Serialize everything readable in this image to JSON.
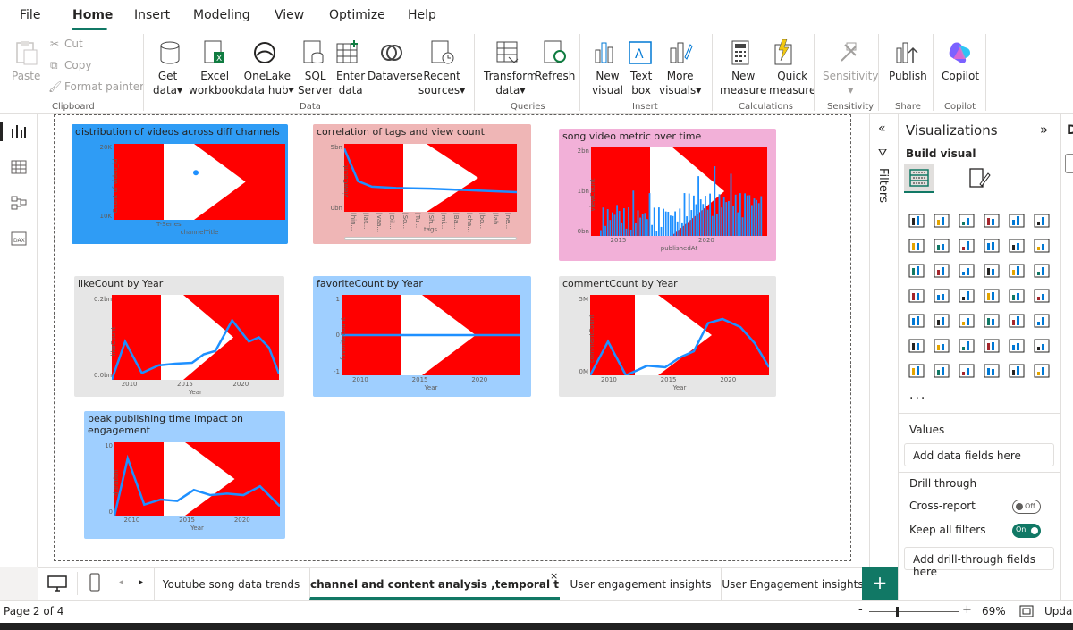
{
  "menu": {
    "items": [
      "File",
      "Home",
      "Insert",
      "Modeling",
      "View",
      "Optimize",
      "Help"
    ]
  },
  "ribbon": {
    "clipboard": {
      "paste": "Paste",
      "cut": "Cut",
      "copy": "Copy",
      "format_painter": "Format painter",
      "group": "Clipboard"
    },
    "data": {
      "get_data_1": "Get",
      "get_data_2": "data",
      "excel_1": "Excel",
      "excel_2": "workbook",
      "onelake_1": "OneLake",
      "onelake_2": "data hub",
      "sql_1": "SQL",
      "sql_2": "Server",
      "enter_1": "Enter",
      "enter_2": "data",
      "dataverse": "Dataverse",
      "recent_1": "Recent",
      "recent_2": "sources",
      "group": "Data"
    },
    "queries": {
      "transform_1": "Transform",
      "transform_2": "data",
      "refresh": "Refresh",
      "group": "Queries"
    },
    "insert": {
      "new_visual_1": "New",
      "new_visual_2": "visual",
      "text_box_1": "Text",
      "text_box_2": "box",
      "more_visuals_1": "More",
      "more_visuals_2": "visuals",
      "group": "Insert"
    },
    "calculations": {
      "new_measure_1": "New",
      "new_measure_2": "measure",
      "quick_measure_1": "Quick",
      "quick_measure_2": "measure",
      "group": "Calculations"
    },
    "sensitivity": {
      "label": "Sensitivity",
      "group": "Sensitivity"
    },
    "share": {
      "publish": "Publish",
      "group": "Share"
    },
    "copilot": {
      "label": "Copilot",
      "group": "Copilot"
    }
  },
  "visuals": [
    {
      "title": "distribution of videos across diff channels",
      "ylabel": "Count of video_id",
      "xlabel": "channelTitle",
      "yticks": [
        "20K",
        "10K"
      ],
      "xticks": [
        "T-Series"
      ]
    },
    {
      "title": "correlation of tags and view count",
      "ylabel": "viewCount",
      "xlabel": "tags",
      "yticks": [
        "5bn",
        "0bn"
      ],
      "xticks": [
        "[hin...",
        "[lat...",
        "[vaa...",
        "[Dil...",
        "[So...",
        "[Tu...",
        "[Sh...",
        "[mi...",
        "[Ba...",
        "[cha...",
        "[bo...",
        "[lah...",
        "[ne..."
      ]
    },
    {
      "title": "song video metric over time",
      "ylabel": "viewCount",
      "xlabel": "publishedAt",
      "yticks": [
        "2bn",
        "1bn",
        "0bn"
      ],
      "xticks": [
        "2015",
        "2020"
      ]
    },
    {
      "title": "likeCount by Year",
      "ylabel": "likeCount",
      "xlabel": "Year",
      "yticks": [
        "0.2bn",
        "0.0bn"
      ],
      "xticks": [
        "2010",
        "2015",
        "2020"
      ]
    },
    {
      "title": "favoriteCount by Year",
      "ylabel": "favoriteCount",
      "xlabel": "Year",
      "yticks": [
        "1",
        "0",
        "-1"
      ],
      "xticks": [
        "2010",
        "2015",
        "2020"
      ]
    },
    {
      "title": "commentCount by Year",
      "ylabel": "commentCount",
      "xlabel": "Year",
      "yticks": [
        "5M",
        "0M"
      ],
      "xticks": [
        "2010",
        "2015",
        "2020"
      ]
    },
    {
      "title": "peak publishing time impact on engagement",
      "ylabel": "duration",
      "xlabel": "Year",
      "yticks": [
        "10",
        "0"
      ],
      "xticks": [
        "2010",
        "2015",
        "2020"
      ]
    }
  ],
  "filters": {
    "label": "Filters"
  },
  "viz_pane": {
    "title": "Visualizations",
    "build_visual": "Build visual",
    "values": "Values",
    "add_data_fields": "Add data fields here",
    "drill_through": "Drill through",
    "cross_report": "Cross-report",
    "cross_report_state": "Off",
    "keep_all_filters": "Keep all filters",
    "keep_all_filters_state": "On",
    "add_drill_fields": "Add drill-through fields here",
    "more": "..."
  },
  "tabs": [
    "Youtube song data trends",
    "channel and content analysis ,temporal tr...",
    "User engagement insights",
    "User Engagement insights"
  ],
  "status": {
    "page": "Page 2 of 4",
    "zoom": "69%",
    "update": "Upda"
  },
  "colors": {
    "accent": "#117865",
    "plot_red": "#ff0000",
    "line_blue": "#1e90ff"
  }
}
